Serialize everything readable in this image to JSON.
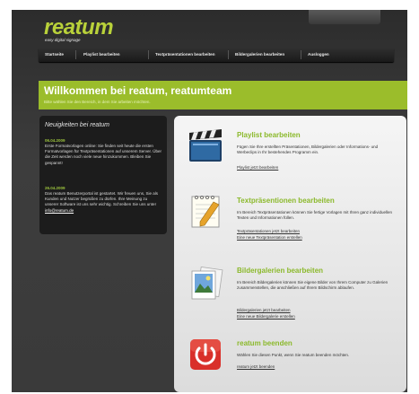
{
  "header": {
    "logo": "reatum",
    "tagline": "easy digital signage"
  },
  "nav": {
    "items": [
      {
        "label": "Startseite"
      },
      {
        "label": "Playlist bearbeiten"
      },
      {
        "label": "Textpräsentationen bearbeiten"
      },
      {
        "label": "Bildergalerien bearbeiten"
      },
      {
        "label": "Ausloggen"
      }
    ]
  },
  "welcome": {
    "title": "Willkommen bei reatum, reatumteam",
    "subtitle": "Bitte wählen Sie den Bereich, in dem Sie arbeiten möchten."
  },
  "news": {
    "title": "Neuigkeiten bei reatum",
    "entries": [
      {
        "date": "06.04.2009",
        "text": "Erste Formatvorlagen online: Sie finden seit heute die ersten Formatvorlagen für Textpräsentationen auf unserem Server. Über die Zeit werden noch viele neue hinzukommen. Bleiben Sie gespannt!"
      },
      {
        "date": "26.04.2009",
        "text": "Das reatum Benutzerportal ist gestartet. Wir freuen uns, Sie als Kunden und Nutzer begrüßen zu dürfen. Ihre Meinung zu unserer Software ist uns sehr wichtig. Schreiben Sie uns unter",
        "link": "info@reatum.de"
      }
    ]
  },
  "sections": [
    {
      "title": "Playlist bearbeiten",
      "desc": "Fügen Sie Ihre erstellten Präsentationen, Bildergalerien oder Informations- und Werbeclips in Ihr bestehendes Programm ein.",
      "links": [
        "Playlist jetzt bearbeiten"
      ],
      "icon": "clapperboard-icon"
    },
    {
      "title": "Textpräsentionen bearbeiten",
      "desc": "Im Bereich Textpräsentationen können Sie fertige Vorlagen mit Ihren ganz individuellen Texten und Informationen füllen.",
      "links": [
        "Textpräsentationen jetzt bearbeiten",
        "Eine neue Textpräsentation erstellen"
      ],
      "icon": "notepad-pencil-icon"
    },
    {
      "title": "Bildergalerien bearbeiten",
      "desc": "Im Bereich Bildergalerien können Sie eigene Bilder von Ihrem Computer zu Galerien zusammenstellen, die anschließen auf Ihrem Bildschirm ablaufen.",
      "links": [
        "Bildergalerien jetzt bearbeiten",
        "Eine neue Bildergalerie erstellen"
      ],
      "icon": "photo-gallery-icon"
    },
    {
      "title": "reatum beenden",
      "desc": "Wählen Sie diesen Punkt, wenn Sie reatum beenden möchten.",
      "links": [
        "reatum jetzt beenden"
      ],
      "icon": "power-button-icon"
    }
  ],
  "colors": {
    "accent": "#9bbd2b",
    "background": "#3a3a3a",
    "panel": "#1c1c1c",
    "power": "#d9302a"
  }
}
